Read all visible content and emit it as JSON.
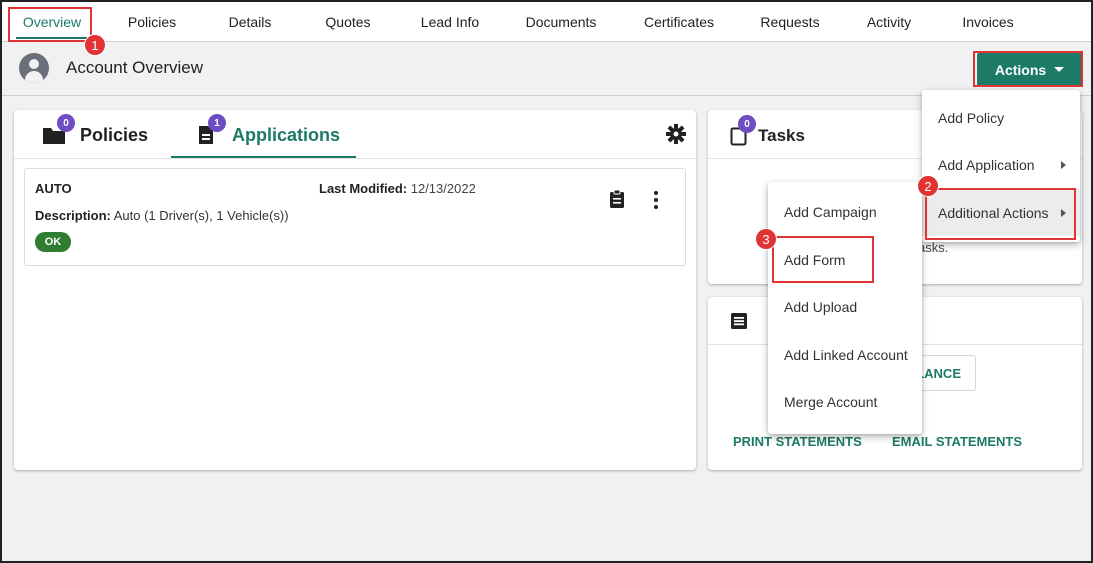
{
  "nav": {
    "tabs": [
      "Overview",
      "Policies",
      "Details",
      "Quotes",
      "Lead Info",
      "Documents",
      "Certificates",
      "Requests",
      "Activity",
      "Invoices"
    ]
  },
  "header": {
    "title": "Account Overview",
    "actions_label": "Actions"
  },
  "policies_card": {
    "tabs": [
      {
        "label": "Policies",
        "count": "0"
      },
      {
        "label": "Applications",
        "count": "1"
      }
    ],
    "application": {
      "title": "AUTO",
      "last_modified_label": "Last Modified:",
      "last_modified_value": "12/13/2022",
      "description_label": "Description:",
      "description_value": "Auto (1 Driver(s), 1 Vehicle(s))",
      "status": "OK"
    }
  },
  "tasks_card": {
    "title": "Tasks",
    "count": "0",
    "partial_text": "asks."
  },
  "billing_card": {
    "partial_button": "LANCE",
    "print_statements": "PRINT STATEMENTS",
    "email_statements": "EMAIL STATEMENTS"
  },
  "actions_menu": {
    "items": [
      "Add Policy",
      "Add Application",
      "Additional Actions"
    ]
  },
  "additional_menu": {
    "items": [
      "Add Campaign",
      "Add Form",
      "Add Upload",
      "Add Linked Account",
      "Merge Account"
    ]
  },
  "annotations": {
    "steps": [
      "1",
      "2",
      "3"
    ]
  },
  "colors": {
    "accent": "#1c7a66",
    "badge": "#6d4cc4",
    "highlight": "#e03434",
    "ok": "#2e7d32"
  }
}
